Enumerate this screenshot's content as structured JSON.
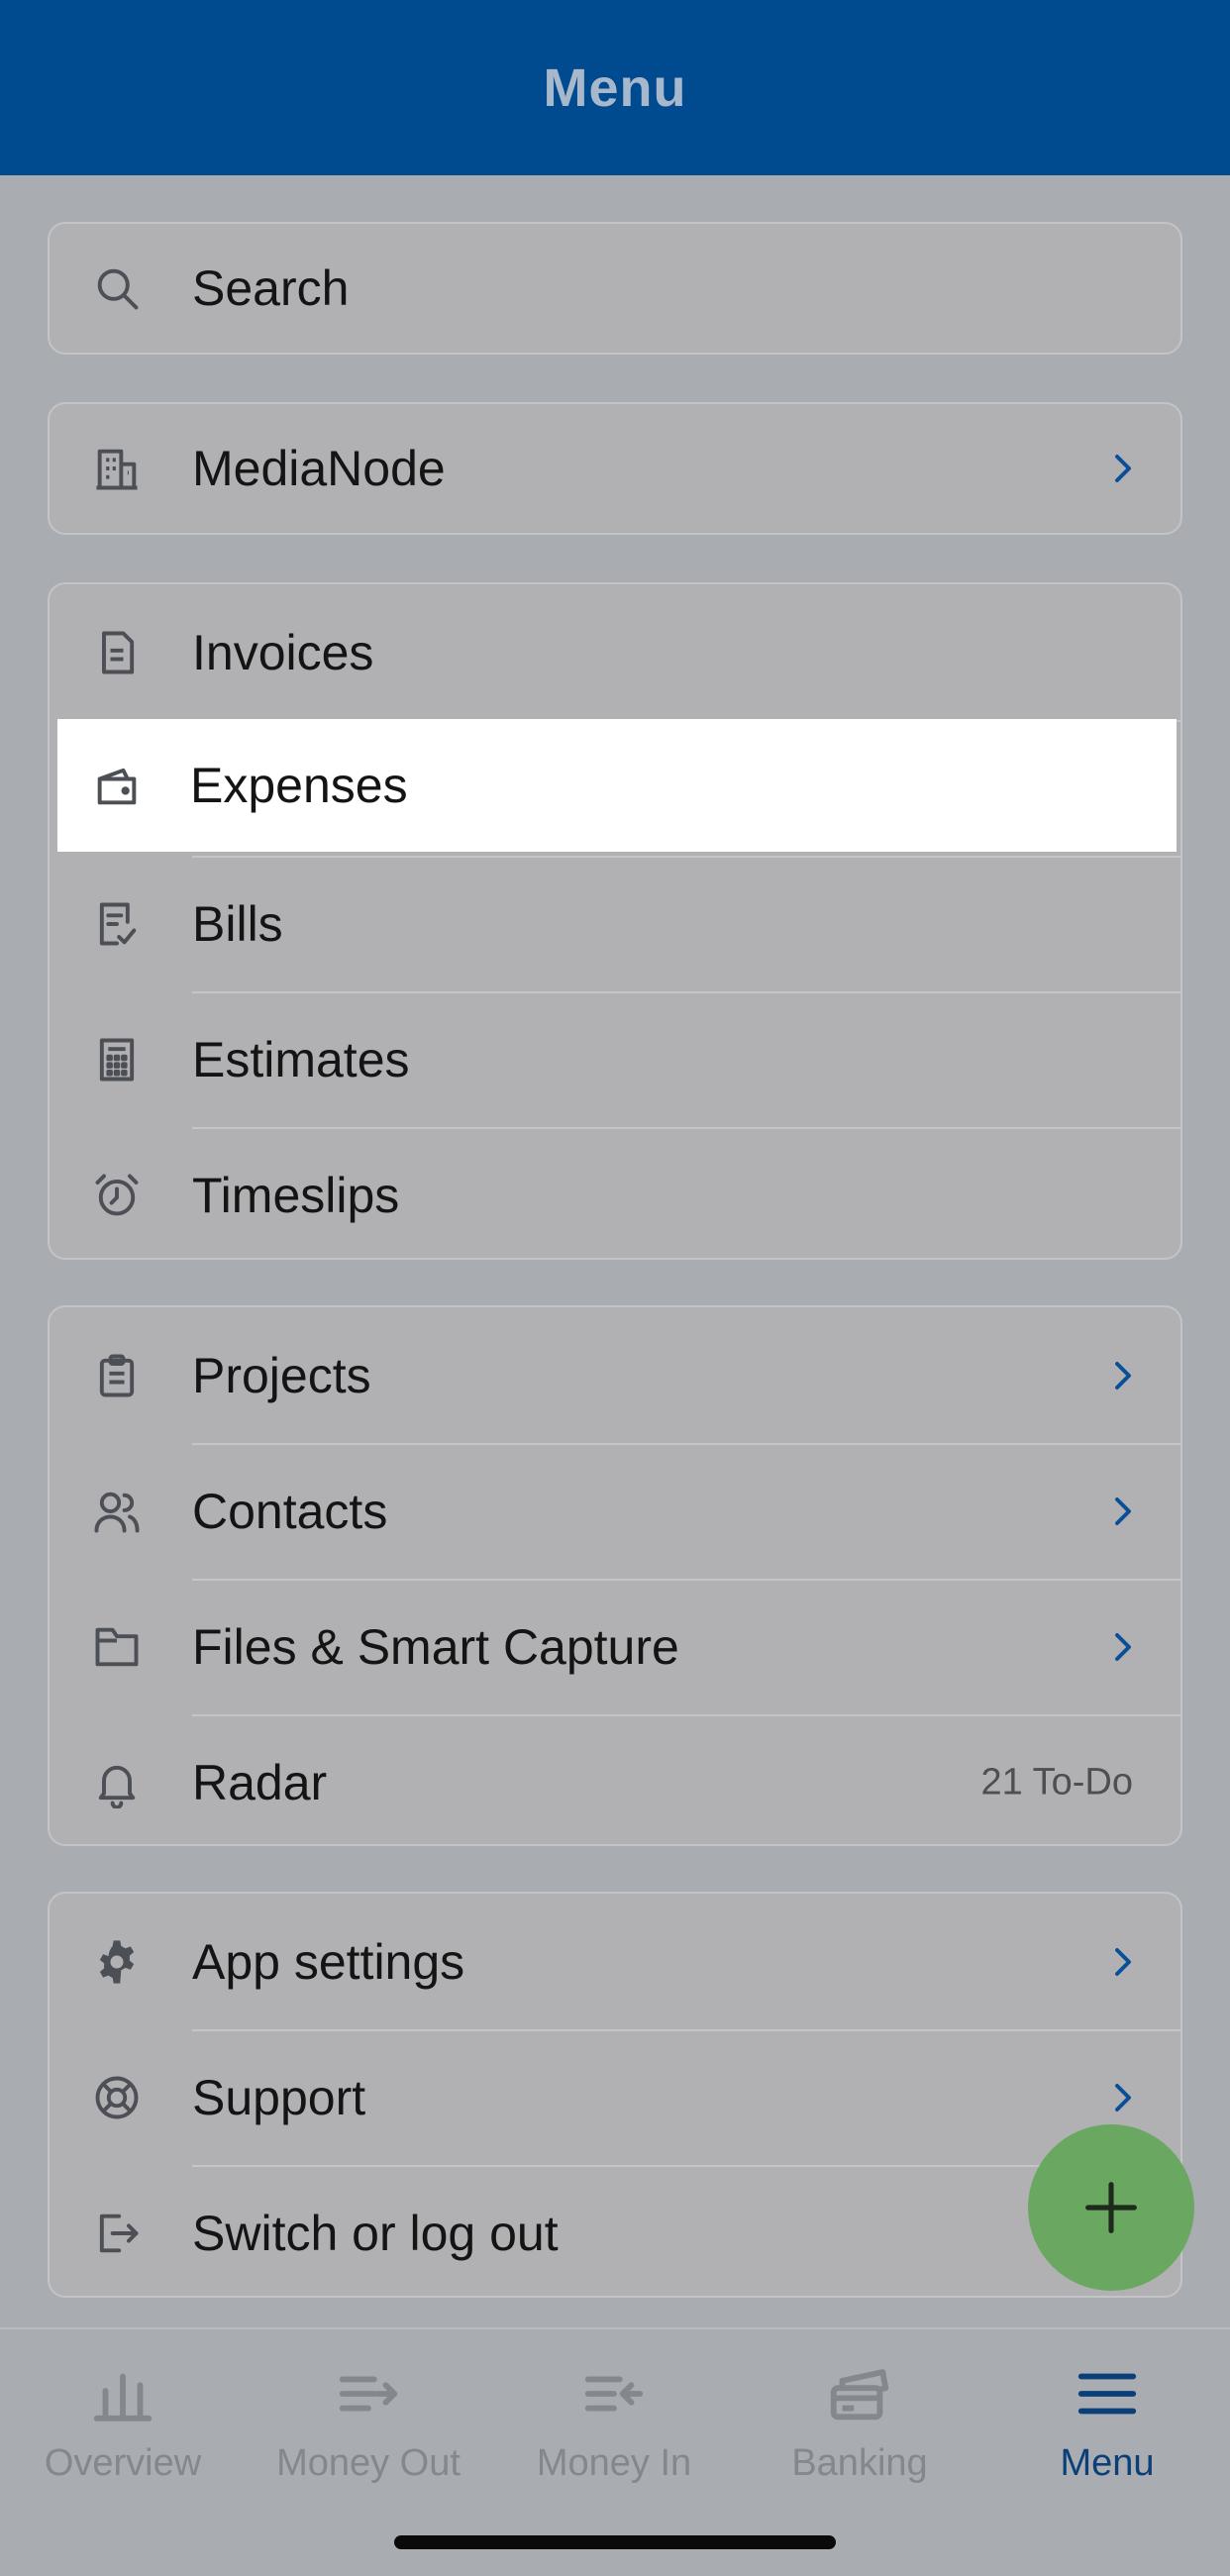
{
  "header": {
    "title": "Menu"
  },
  "search": {
    "label": "Search"
  },
  "org": {
    "label": "MediaNode"
  },
  "group_docs": {
    "items": [
      {
        "label": "Invoices"
      },
      {
        "label": "Expenses"
      },
      {
        "label": "Bills"
      },
      {
        "label": "Estimates"
      },
      {
        "label": "Timeslips"
      }
    ]
  },
  "group_work": {
    "items": [
      {
        "label": "Projects"
      },
      {
        "label": "Contacts"
      },
      {
        "label": "Files & Smart Capture"
      },
      {
        "label": "Radar",
        "badge": "21 To-Do"
      }
    ]
  },
  "group_settings": {
    "items": [
      {
        "label": "App settings"
      },
      {
        "label": "Support"
      },
      {
        "label": "Switch or log out"
      }
    ]
  },
  "tabbar": {
    "tabs": [
      {
        "label": "Overview"
      },
      {
        "label": "Money Out"
      },
      {
        "label": "Money In"
      },
      {
        "label": "Banking"
      },
      {
        "label": "Menu"
      }
    ]
  },
  "colors": {
    "header_bg": "#004b8f",
    "accent": "#0a4f96",
    "fab": "#6aa862",
    "overlay": "#a9acb1"
  }
}
